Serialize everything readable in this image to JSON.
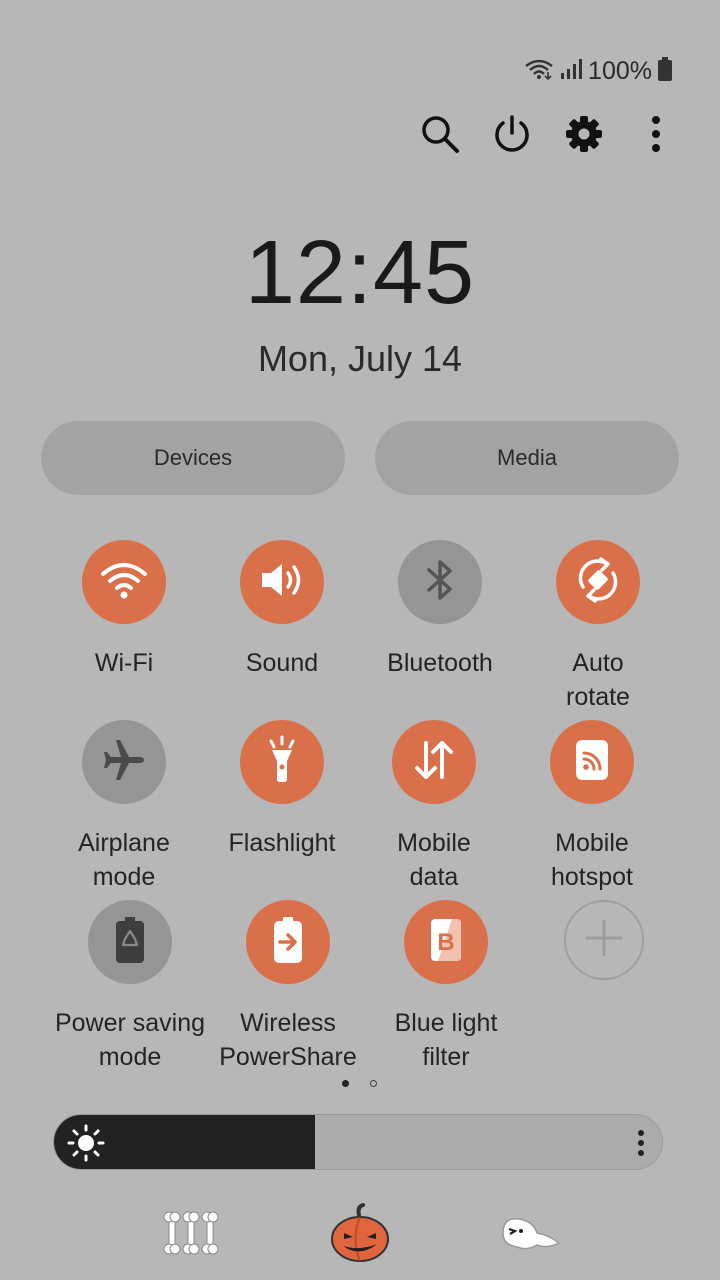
{
  "status_bar": {
    "battery_text": "100%",
    "wifi_icon": "wifi-icon",
    "signal_icon": "signal-icon",
    "battery_icon": "battery-icon"
  },
  "top_actions": [
    {
      "name": "search-button",
      "icon": "search-icon"
    },
    {
      "name": "power-button",
      "icon": "power-icon"
    },
    {
      "name": "settings-button",
      "icon": "gear-icon"
    },
    {
      "name": "more-options-button",
      "icon": "more-vertical-icon"
    }
  ],
  "clock": {
    "time": "12:45",
    "date": "Mon, July 14"
  },
  "pills": {
    "devices": "Devices",
    "media": "Media"
  },
  "tiles": [
    {
      "label": "Wi-Fi",
      "state": "on",
      "icon": "wifi-icon"
    },
    {
      "label": "Sound",
      "state": "on",
      "icon": "speaker-icon"
    },
    {
      "label": "Bluetooth",
      "state": "off",
      "icon": "bluetooth-icon"
    },
    {
      "label": "Auto\nrotate",
      "state": "on",
      "icon": "auto-rotate-icon"
    },
    {
      "label": "Airplane\nmode",
      "state": "off",
      "icon": "airplane-icon"
    },
    {
      "label": "Flashlight",
      "state": "on",
      "icon": "flashlight-icon"
    },
    {
      "label": "Mobile\ndata",
      "state": "on",
      "icon": "mobile-data-icon"
    },
    {
      "label": "Mobile\nhotspot",
      "state": "on",
      "icon": "hotspot-icon"
    },
    {
      "label": "Power saving\nmode",
      "state": "off",
      "icon": "power-saving-icon"
    },
    {
      "label": "Wireless\nPowerShare",
      "state": "on",
      "icon": "wireless-powershare-icon"
    },
    {
      "label": "Blue light\nfilter",
      "state": "on",
      "icon": "blue-light-filter-icon"
    },
    {
      "label": "",
      "state": "add",
      "icon": "plus-icon"
    }
  ],
  "pagination": {
    "current_page": 1,
    "total_pages": 2
  },
  "brightness": {
    "level": 0.43,
    "icon": "sun-icon"
  },
  "decorations": [
    "bones-icon",
    "pumpkin-icon",
    "ghost-icon"
  ],
  "colors": {
    "background": "#b7b7b7",
    "accent": "#d9704a",
    "tile_off": "#959595",
    "pill": "#a3a3a3"
  }
}
